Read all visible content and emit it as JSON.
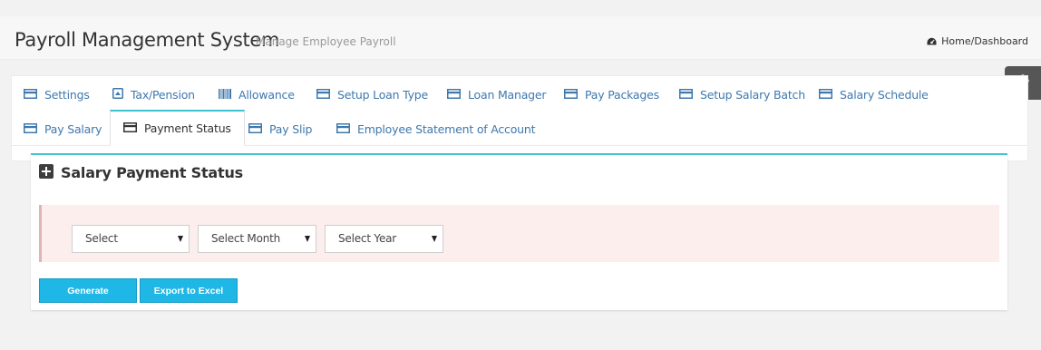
{
  "header": {
    "title": "Payroll Management System",
    "subtitle": "Manage Employee Payroll",
    "breadcrumb": "Home/Dashboard"
  },
  "tabs": [
    {
      "label": "Settings",
      "icon": "credit-card-icon",
      "active": false
    },
    {
      "label": "Tax/Pension",
      "icon": "caret-square-up-icon",
      "active": false
    },
    {
      "label": "Allowance",
      "icon": "barcode-icon",
      "active": false
    },
    {
      "label": "Setup Loan Type",
      "icon": "credit-card-icon",
      "active": false
    },
    {
      "label": "Loan Manager",
      "icon": "credit-card-icon",
      "active": false
    },
    {
      "label": "Pay Packages",
      "icon": "credit-card-icon",
      "active": false
    },
    {
      "label": "Setup Salary Batch",
      "icon": "credit-card-icon",
      "active": false
    },
    {
      "label": "Salary Schedule",
      "icon": "credit-card-icon",
      "active": false
    },
    {
      "label": "Pay Salary",
      "icon": "credit-card-icon",
      "active": false
    },
    {
      "label": "Payment Status",
      "icon": "credit-card-icon",
      "active": true
    },
    {
      "label": "Pay Slip",
      "icon": "credit-card-icon",
      "active": false
    },
    {
      "label": "Employee Statement of Account",
      "icon": "credit-card-icon",
      "active": false
    }
  ],
  "panel": {
    "title": "Salary Payment Status",
    "icon": "plus-square-icon"
  },
  "filters": {
    "select_1": "Select",
    "month": "Select Month",
    "year": "Select Year"
  },
  "buttons": {
    "generate": "Generate",
    "export": "Export to Excel"
  },
  "colors": {
    "accent": "#3fc3d0",
    "link": "#3e78ad",
    "button": "#1fb7e6",
    "filter_bg": "#fbeeec"
  }
}
